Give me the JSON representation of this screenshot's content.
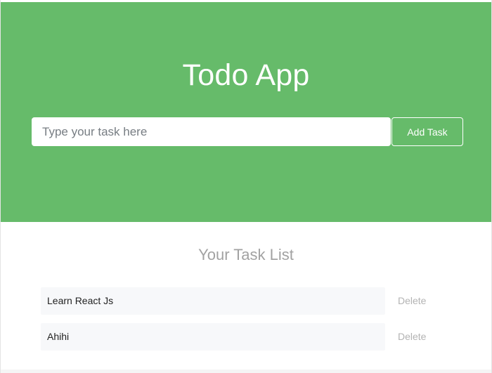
{
  "header": {
    "title": "Todo App",
    "background_color": "#66bb6a"
  },
  "new_task": {
    "placeholder": "Type your task here",
    "value": "",
    "add_label": "Add Task"
  },
  "task_list": {
    "title": "Your Task List",
    "items": [
      {
        "text": "Learn React Js",
        "delete_label": "Delete"
      },
      {
        "text": "Ahihi",
        "delete_label": "Delete"
      }
    ]
  }
}
